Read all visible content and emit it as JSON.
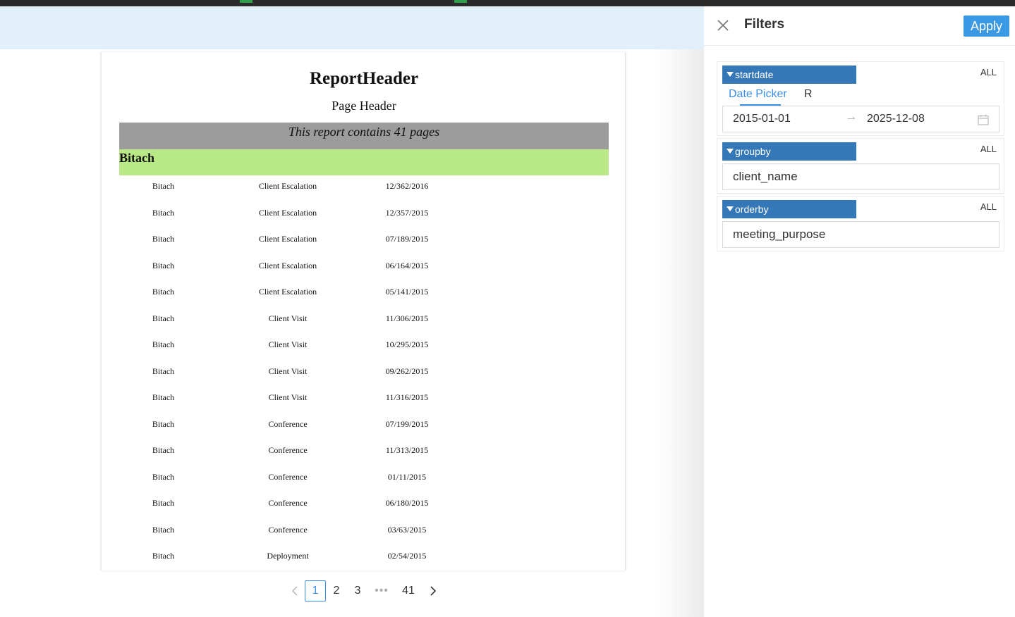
{
  "report": {
    "title": "ReportHeader",
    "page_header": "Page Header",
    "pages_note": "This report contains 41 pages",
    "group_name": "Bitach",
    "rows": [
      [
        "Bitach",
        "Client Escalation",
        "12/362/2016"
      ],
      [
        "Bitach",
        "Client Escalation",
        "12/357/2015"
      ],
      [
        "Bitach",
        "Client Escalation",
        "07/189/2015"
      ],
      [
        "Bitach",
        "Client Escalation",
        "06/164/2015"
      ],
      [
        "Bitach",
        "Client Escalation",
        "05/141/2015"
      ],
      [
        "Bitach",
        "Client Visit",
        "11/306/2015"
      ],
      [
        "Bitach",
        "Client Visit",
        "10/295/2015"
      ],
      [
        "Bitach",
        "Client Visit",
        "09/262/2015"
      ],
      [
        "Bitach",
        "Client Visit",
        "11/316/2015"
      ],
      [
        "Bitach",
        "Conference",
        "07/199/2015"
      ],
      [
        "Bitach",
        "Conference",
        "11/313/2015"
      ],
      [
        "Bitach",
        "Conference",
        "01/11/2015"
      ],
      [
        "Bitach",
        "Conference",
        "06/180/2015"
      ],
      [
        "Bitach",
        "Conference",
        "03/63/2015"
      ],
      [
        "Bitach",
        "Deployment",
        "02/54/2015"
      ]
    ]
  },
  "pager": {
    "pages": [
      "1",
      "2",
      "3"
    ],
    "ellipsis": "•••",
    "last": "41",
    "current": "1",
    "prev_icon": "chevron-left-icon",
    "next_icon": "chevron-right-icon"
  },
  "filters_panel": {
    "title": "Filters",
    "apply_label": "Apply",
    "close_icon": "close-icon",
    "filters": [
      {
        "name": "startdate",
        "all_label": "ALL",
        "tabs": [
          "Date Picker",
          "R"
        ],
        "start": "2015-01-01",
        "end": "2025-12-08",
        "calendar_icon": "calendar-icon"
      },
      {
        "name": "groupby",
        "all_label": "ALL",
        "value": "client_name"
      },
      {
        "name": "orderby",
        "all_label": "ALL",
        "value": "meeting_purpose"
      }
    ]
  },
  "colors": {
    "accent": "#3a99e5",
    "filter_tag": "#3578b8",
    "group_band": "#b9e887",
    "pages_band": "#9c9c9c",
    "banner": "#e0eff8"
  }
}
